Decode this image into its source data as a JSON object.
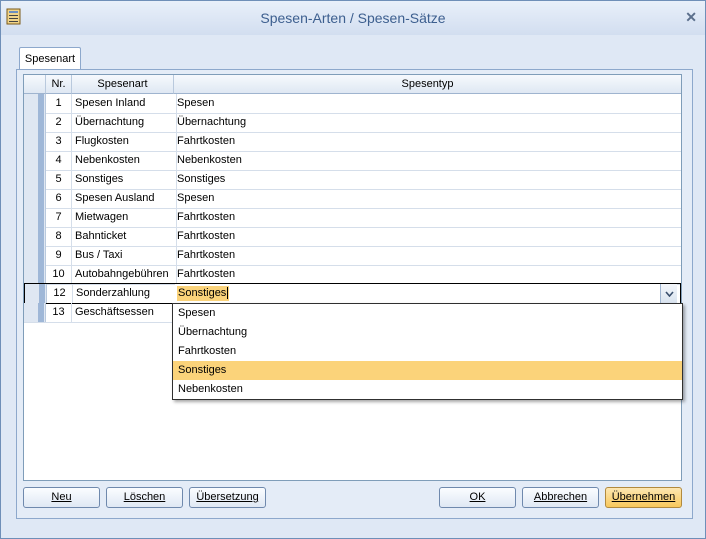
{
  "window": {
    "title": "Spesen-Arten / Spesen-Sätze"
  },
  "tabs": [
    {
      "label": "Spesenart"
    }
  ],
  "grid": {
    "columns": {
      "nr": "Nr.",
      "spesenart": "Spesenart",
      "spesentyp": "Spesentyp"
    },
    "rows": [
      {
        "nr": "1",
        "spesenart": "Spesen Inland",
        "spesentyp": "Spesen"
      },
      {
        "nr": "2",
        "spesenart": "Übernachtung",
        "spesentyp": "Übernachtung"
      },
      {
        "nr": "3",
        "spesenart": "Flugkosten",
        "spesentyp": "Fahrtkosten"
      },
      {
        "nr": "4",
        "spesenart": "Nebenkosten",
        "spesentyp": "Nebenkosten"
      },
      {
        "nr": "5",
        "spesenart": "Sonstiges",
        "spesentyp": "Sonstiges"
      },
      {
        "nr": "6",
        "spesenart": "Spesen Ausland",
        "spesentyp": "Spesen"
      },
      {
        "nr": "7",
        "spesenart": "Mietwagen",
        "spesentyp": "Fahrtkosten"
      },
      {
        "nr": "8",
        "spesenart": "Bahnticket",
        "spesentyp": "Fahrtkosten"
      },
      {
        "nr": "9",
        "spesenart": "Bus / Taxi",
        "spesentyp": "Fahrtkosten"
      },
      {
        "nr": "10",
        "spesenart": "Autobahngebühren",
        "spesentyp": "Fahrtkosten"
      },
      {
        "nr": "12",
        "spesenart": "Sonderzahlung",
        "spesentyp": "Sonstiges"
      },
      {
        "nr": "13",
        "spesenart": "Geschäftsessen",
        "spesentyp": ""
      }
    ],
    "editing_value": "Sonstiges",
    "dropdown_options": [
      "Spesen",
      "Übernachtung",
      "Fahrtkosten",
      "Sonstiges",
      "Nebenkosten"
    ],
    "dropdown_selected": "Sonstiges"
  },
  "buttons": {
    "neu": "Neu",
    "loeschen": "Löschen",
    "uebersetzung": "Übersetzung",
    "ok": "OK",
    "abbrechen": "Abbrechen",
    "uebernehmen": "Übernehmen"
  },
  "colors": {
    "highlight": "#fbd37a",
    "title": "#3d5f8f"
  },
  "icons": {
    "app": "table-book-icon",
    "close": "close-icon",
    "dropdown": "chevron-down-icon"
  }
}
